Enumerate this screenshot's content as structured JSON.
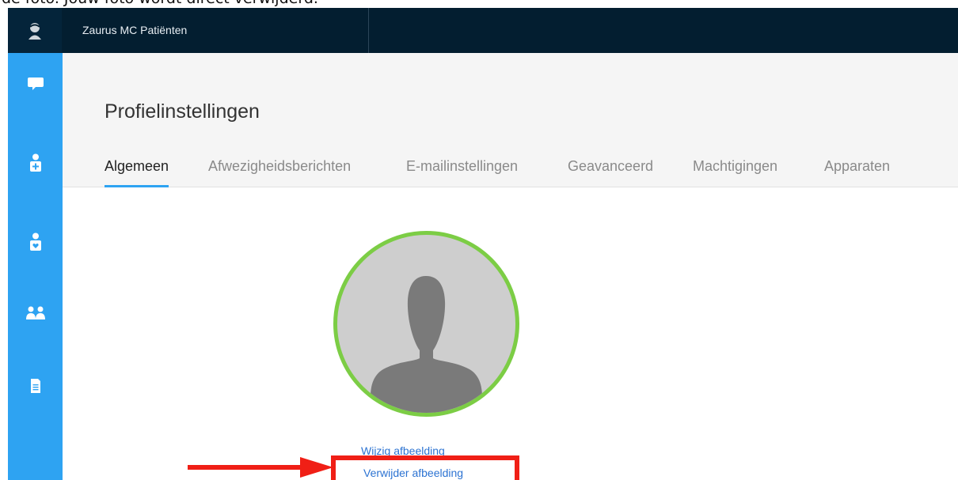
{
  "caption": {
    "text": "de foto. Jouw foto wordt direct verwijderd."
  },
  "topbar": {
    "app_title": "Zaurus MC Patiënten",
    "bg_color": "#031e30",
    "logo_icon": "user-logo-icon"
  },
  "sidebar": {
    "color": "#2ea3f2",
    "items": [
      {
        "name": "chat-icon"
      },
      {
        "name": "patient-add-icon"
      },
      {
        "name": "patient-heart-icon"
      },
      {
        "name": "group-icon"
      },
      {
        "name": "document-icon"
      }
    ]
  },
  "page": {
    "title": "Profielinstellingen",
    "tabs": [
      {
        "label": "Algemeen",
        "active": true
      },
      {
        "label": "Afwezigheidsberichten",
        "active": false
      },
      {
        "label": "E-mailinstellingen",
        "active": false
      },
      {
        "label": "Geavanceerd",
        "active": false
      },
      {
        "label": "Machtigingen",
        "active": false
      },
      {
        "label": "Apparaten",
        "active": false
      }
    ]
  },
  "profile": {
    "avatar_icon": "person-silhouette-icon",
    "ring_color": "#7ccd45",
    "change_label": "Wijzig afbeelding",
    "remove_label": "Verwijder afbeelding"
  },
  "annotation": {
    "color": "#f01f16",
    "arrow_icon": "arrow-right-icon"
  }
}
